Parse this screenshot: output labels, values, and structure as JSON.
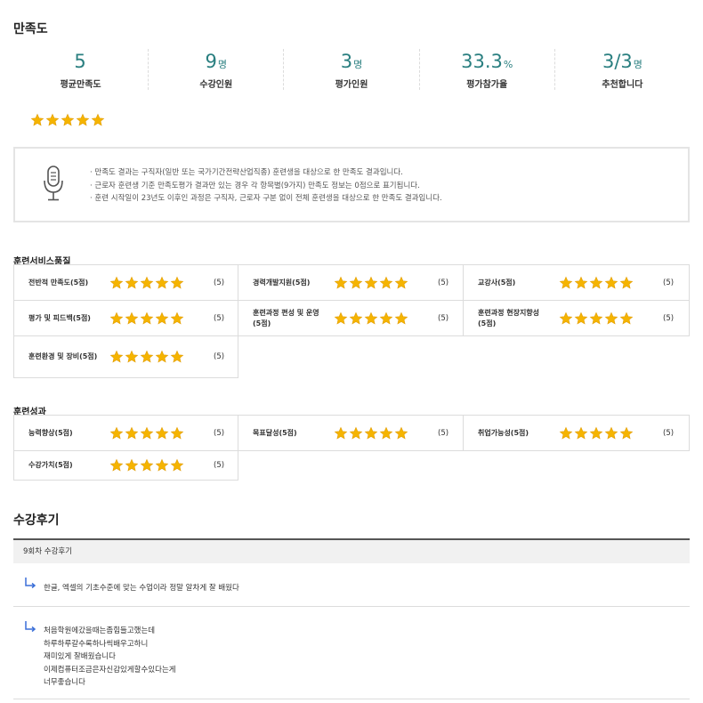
{
  "satisfaction": {
    "title": "만족도",
    "stats": [
      {
        "value": "5",
        "unit": "",
        "label": "평균만족도"
      },
      {
        "value": "9",
        "unit": "명",
        "label": "수강인원"
      },
      {
        "value": "3",
        "unit": "명",
        "label": "평가인원"
      },
      {
        "value": "33.3",
        "unit": "%",
        "label": "평가참가율"
      },
      {
        "value": "3/3",
        "unit": "명",
        "label": "추천합니다"
      }
    ],
    "overall_rating": 5,
    "notice_lines": [
      "만족도 결과는 구직자(일반 또는 국가기간전략산업직종) 훈련생을 대상으로 한 만족도 결과입니다.",
      "근로자 훈련생 기준 만족도평가 결과만 있는 경우 각 항목별(9가지) 만족도 정보는 0점으로 표기됩니다.",
      "훈련 시작일이 23년도 이후인 과정은 구직자, 근로자 구분 없이 전체 훈련생을 대상으로 한 만족도 결과입니다."
    ]
  },
  "service_quality": {
    "title": "훈련서비스품질",
    "items": [
      {
        "label": "전반적 만족도(5점)",
        "score": "(5)",
        "rating": 5
      },
      {
        "label": "경력개발지원(5점)",
        "score": "(5)",
        "rating": 5
      },
      {
        "label": "교강사(5점)",
        "score": "(5)",
        "rating": 5
      },
      {
        "label": "평가 및 피드백(5점)",
        "score": "(5)",
        "rating": 5
      },
      {
        "label": "훈련과정 편성 및 운영(5점)",
        "score": "(5)",
        "rating": 5
      },
      {
        "label": "훈련과정 현장지향성(5점)",
        "score": "(5)",
        "rating": 5
      },
      {
        "label": "훈련환경 및 장비(5점)",
        "score": "(5)",
        "rating": 5
      }
    ]
  },
  "outcomes": {
    "title": "훈련성과",
    "items": [
      {
        "label": "능력향상(5점)",
        "score": "(5)",
        "rating": 5
      },
      {
        "label": "목표달성(5점)",
        "score": "(5)",
        "rating": 5
      },
      {
        "label": "취업가능성(5점)",
        "score": "(5)",
        "rating": 5
      },
      {
        "label": "수강가치(5점)",
        "score": "(5)",
        "rating": 5
      }
    ]
  },
  "reviews": {
    "title": "수강후기",
    "round_label": "9회차 수강후기",
    "items": [
      {
        "text": "한글, 엑셀의 기초수준에 맞는 수업이라 정말 알차게 잘 배웠다"
      },
      {
        "text": "처음학원에갔을때는좀힘들고했는데\n하루하루갈수록하나씩배우고하니\n재미있게 잘배웠습니다\n이제컴퓨터조금은자신감있게할수있다는게\n너무좋습니다"
      }
    ]
  },
  "colors": {
    "accent": "#2a7f80",
    "star": "#f5b400",
    "reply_icon": "#3b6fd8"
  }
}
